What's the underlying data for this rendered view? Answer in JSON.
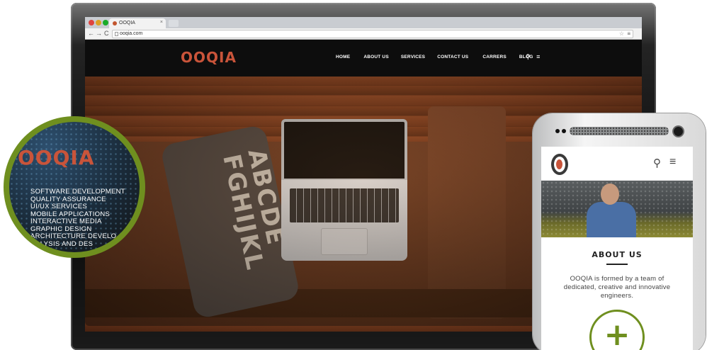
{
  "browser": {
    "tab_title": "OOQIA",
    "tab_close": "×",
    "url": "ooqia.com",
    "back_icon": "←",
    "forward_icon": "→",
    "reload_icon": "C",
    "star_icon": "☆",
    "menu_icon": "≡"
  },
  "site": {
    "logo_text": "OOQIA",
    "nav": [
      {
        "label": "HOME"
      },
      {
        "label": "ABOUT US"
      },
      {
        "label": "SERVICES"
      },
      {
        "label": "CONTACT US"
      },
      {
        "label": "CARRERS"
      },
      {
        "label": "BLOG"
      }
    ],
    "search_icon": "⚲",
    "menu_icon": "≡",
    "hero_pillow_text": "ABCDE FGHIJKL"
  },
  "badge": {
    "logo_text": "OOQIA",
    "services": [
      "SOFTWARE DEVELOPMENT",
      "QUALITY ASSURANCE",
      "UI/UX SERVICES",
      "MOBILE APPLICATIONS",
      "INTERACTIVE MEDIA",
      "GRAPHIC DESIGN",
      "ARCHITECTURE DEVELO",
      "NALYSIS AND DES"
    ]
  },
  "mobile": {
    "search_icon": "⚲",
    "menu_icon": "≡",
    "section_title": "ABOUT US",
    "about_text": "OOQIA is formed by a team of dedicated, creative and innovative engineers.",
    "plus_label": "+"
  },
  "colors": {
    "brand": "#c9543a",
    "accent_green": "#6f8f1f",
    "header_bg": "#0d0d0d"
  }
}
